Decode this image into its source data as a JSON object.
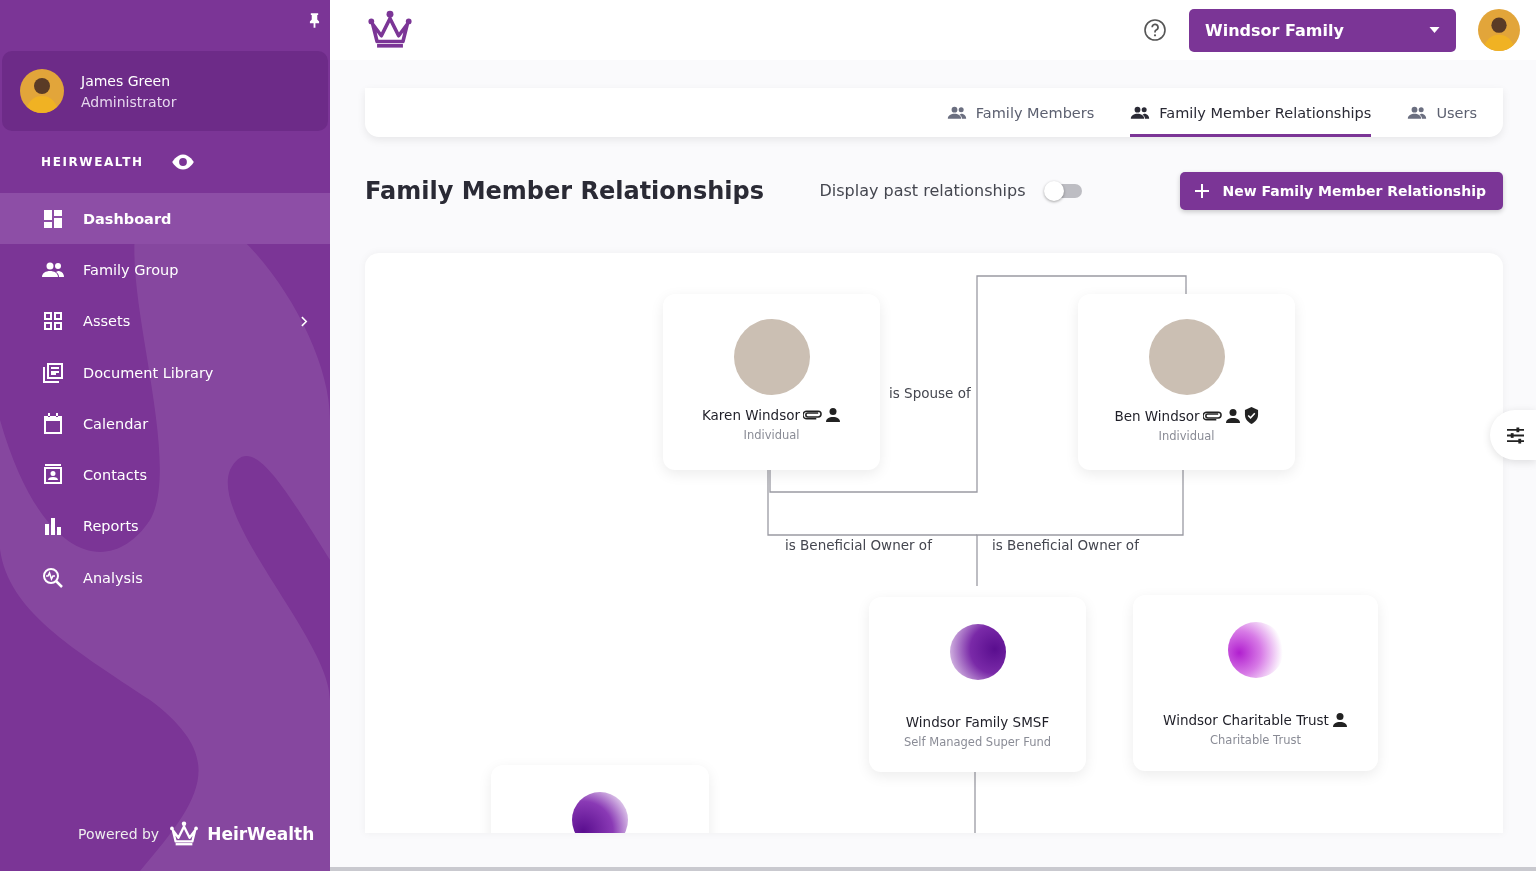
{
  "sidebar": {
    "pinned": true,
    "user": {
      "name": "James Green",
      "role": "Administrator"
    },
    "brand": {
      "label": "HEIRWEALTH",
      "visible": true
    },
    "items": [
      {
        "label": "Dashboard",
        "selected": true,
        "has_submenu": false
      },
      {
        "label": "Family Group",
        "selected": false,
        "has_submenu": false
      },
      {
        "label": "Assets",
        "selected": false,
        "has_submenu": true
      },
      {
        "label": "Document Library",
        "selected": false,
        "has_submenu": false
      },
      {
        "label": "Calendar",
        "selected": false,
        "has_submenu": false
      },
      {
        "label": "Contacts",
        "selected": false,
        "has_submenu": false
      },
      {
        "label": "Reports",
        "selected": false,
        "has_submenu": false
      },
      {
        "label": "Analysis",
        "selected": false,
        "has_submenu": false
      }
    ],
    "footer": {
      "powered_by": "Powered by",
      "logo_text": "HeirWealth"
    }
  },
  "header": {
    "family_select": {
      "value": "Windsor Family"
    }
  },
  "tabs": [
    {
      "label": "Family Members",
      "selected": false
    },
    {
      "label": "Family Member Relationships",
      "selected": true
    },
    {
      "label": "Users",
      "selected": false
    }
  ],
  "page": {
    "title": "Family Member Relationships",
    "past_toggle": {
      "label": "Display past relationships",
      "on": false
    },
    "new_button": "New Family Member Relationship"
  },
  "diagram": {
    "nodes": [
      {
        "kind": "person",
        "name": "Karen Windsor",
        "type": "Individual",
        "attachment": true,
        "linked_user": true,
        "verified": false
      },
      {
        "kind": "person",
        "name": "Ben Windsor",
        "type": "Individual",
        "attachment": true,
        "linked_user": true,
        "verified": true
      },
      {
        "kind": "entity",
        "name": "Windsor Family SMSF",
        "type": "Self Managed Super Fund",
        "attachment": false,
        "linked_user": false,
        "verified": false
      },
      {
        "kind": "entity",
        "name": "Windsor Charitable Trust",
        "type": "Charitable Trust",
        "attachment": false,
        "linked_user": true,
        "verified": false
      },
      {
        "kind": "entity"
      }
    ],
    "relationships": [
      {
        "label": "is Spouse of"
      },
      {
        "label": "is Beneficial Owner of"
      },
      {
        "label": "is Beneficial Owner of"
      }
    ]
  }
}
